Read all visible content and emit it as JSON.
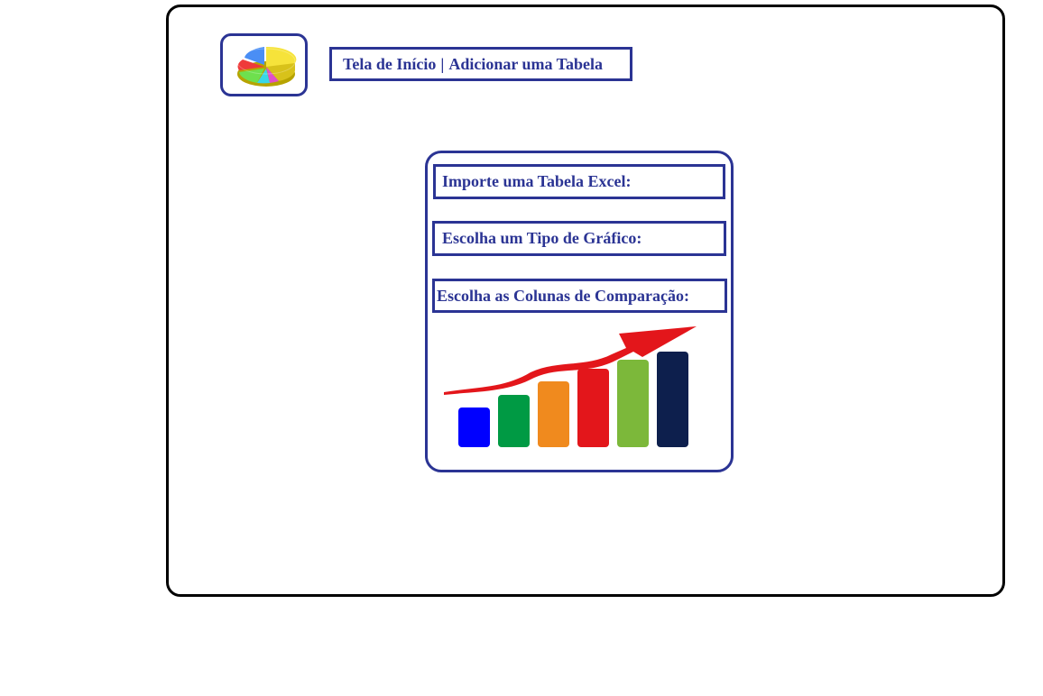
{
  "header": {
    "logo_icon": "pie-chart-icon",
    "breadcrumb": {
      "home_label": "Tela de Início",
      "separator": "|",
      "current_label": "Adicionar uma Tabela"
    }
  },
  "panel": {
    "fields": [
      {
        "label": "Importe uma Tabela Excel:"
      },
      {
        "label": "Escolha um Tipo de Gráfico:"
      },
      {
        "label": "Escolha as Colunas de Comparação:"
      }
    ],
    "illustration_icon": "growth-bar-chart-icon"
  },
  "colors": {
    "accent": "#2b3494",
    "window_border": "#000000",
    "bars": [
      "#0000ff",
      "#009a44",
      "#f08a1e",
      "#e3161b",
      "#7cb83a",
      "#0d1f4d"
    ],
    "arrow": "#e3161b"
  }
}
